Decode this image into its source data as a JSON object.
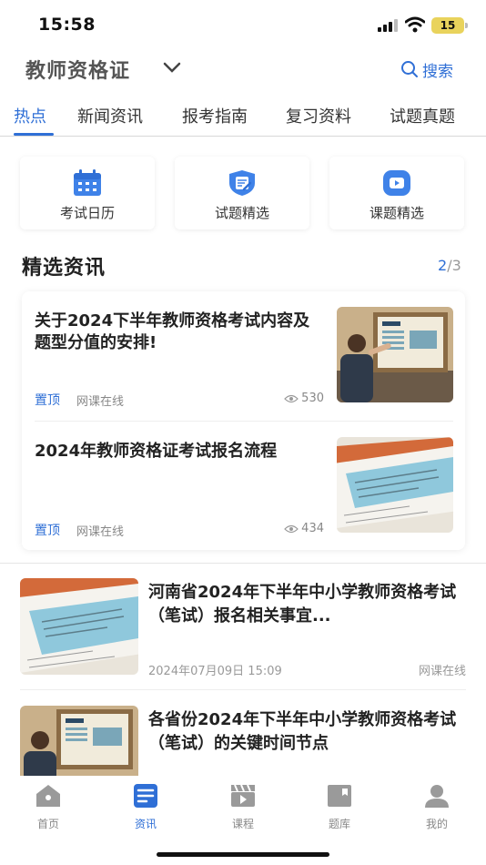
{
  "status_bar": {
    "time": "15:58",
    "battery": "15"
  },
  "header": {
    "title": "教师资格证",
    "search_label": "搜索"
  },
  "tabs": [
    {
      "label": "热点",
      "active": true
    },
    {
      "label": "新闻资讯"
    },
    {
      "label": "报考指南"
    },
    {
      "label": "复习资料"
    },
    {
      "label": "试题真题"
    }
  ],
  "quick_entries": [
    {
      "label": "考试日历",
      "icon": "calendar-icon"
    },
    {
      "label": "试题精选",
      "icon": "exam-shield-icon"
    },
    {
      "label": "课题精选",
      "icon": "video-play-icon"
    }
  ],
  "featured": {
    "title": "精选资讯",
    "page_current": "2",
    "page_total": "/3",
    "items": [
      {
        "title": "关于2024下半年教师资格考试内容及题型分值的安排!",
        "pin": "置顶",
        "source": "网课在线",
        "views": "530",
        "thumb": "teacher-exam-illustration"
      },
      {
        "title": "2024年教师资格证考试报名流程",
        "pin": "置顶",
        "source": "网课在线",
        "views": "434",
        "thumb": "application-form-illustration"
      }
    ]
  },
  "news_list": [
    {
      "title": "河南省2024年下半年中小学教师资格考试（笔试）报名相关事宜...",
      "date": "2024年07月09日 15:09",
      "source": "网课在线",
      "thumb": "application-form-illustration"
    },
    {
      "title": "各省份2024年下半年中小学教师资格考试（笔试）的关键时间节点",
      "date": "",
      "source": "",
      "thumb": "teacher-exam-illustration"
    }
  ],
  "bottom_nav": [
    {
      "label": "首页",
      "icon": "home-icon"
    },
    {
      "label": "资讯",
      "icon": "news-icon",
      "active": true
    },
    {
      "label": "课程",
      "icon": "course-clapper-icon"
    },
    {
      "label": "题库",
      "icon": "question-bank-icon"
    },
    {
      "label": "我的",
      "icon": "profile-icon"
    }
  ],
  "colors": {
    "accent": "#2f6fd6",
    "text": "#222222",
    "muted": "#888888"
  }
}
